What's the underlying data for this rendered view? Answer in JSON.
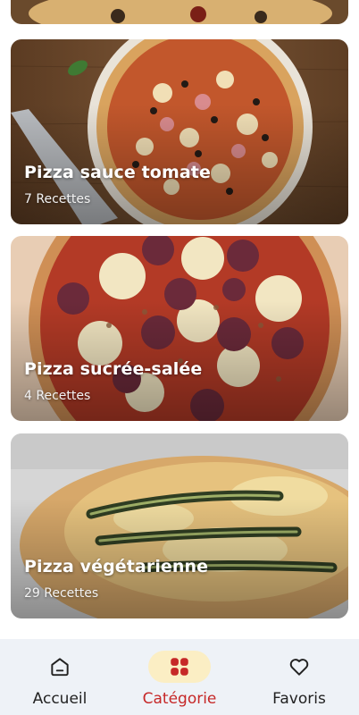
{
  "colors": {
    "accent_red": "#c62828",
    "active_pill": "#fbeec4",
    "nav_background": "#eef2f7",
    "top_line": "#e3403b"
  },
  "categories": [
    {
      "title": "Pizza sauce tomate",
      "count": "7 Recettes"
    },
    {
      "title": "Pizza sucrée-salée",
      "count": "4 Recettes"
    },
    {
      "title": "Pizza végétarienne",
      "count": "29 Recettes"
    }
  ],
  "bottom_nav": {
    "items": [
      {
        "label": "Accueil",
        "icon": "home-icon",
        "active": false
      },
      {
        "label": "Catégorie",
        "icon": "grid-icon",
        "active": true
      },
      {
        "label": "Favoris",
        "icon": "heart-icon",
        "active": false
      }
    ]
  }
}
